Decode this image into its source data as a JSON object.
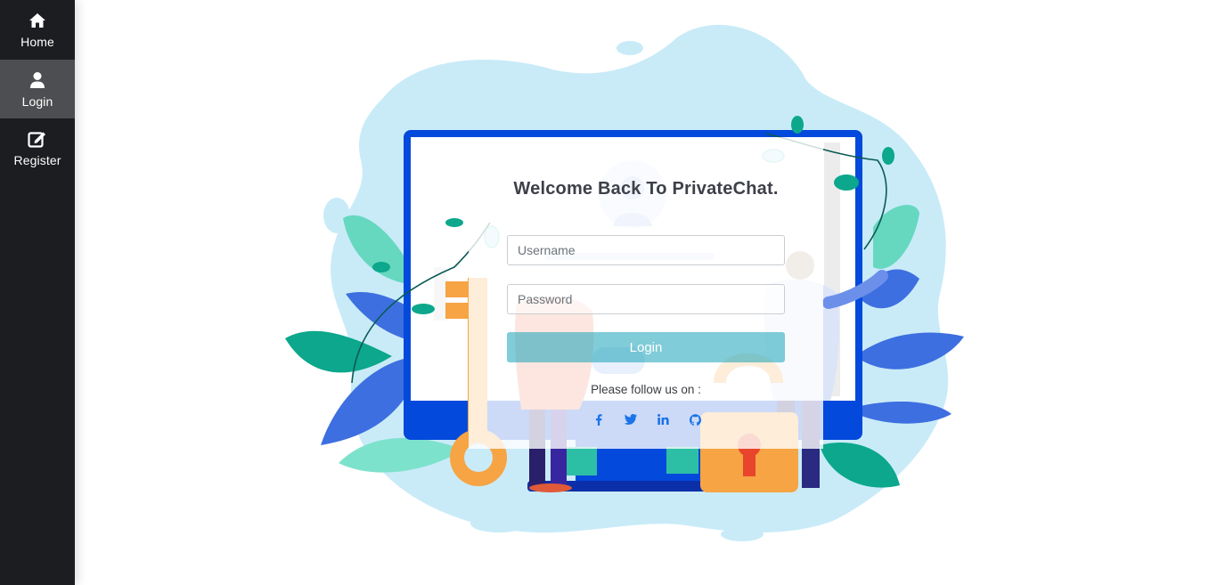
{
  "sidebar": {
    "items": [
      {
        "label": "Home",
        "icon": "home-icon",
        "active": false
      },
      {
        "label": "Login",
        "icon": "user-icon",
        "active": true
      },
      {
        "label": "Register",
        "icon": "edit-icon",
        "active": false
      }
    ]
  },
  "login": {
    "title": "Welcome Back To PrivateChat.",
    "username_placeholder": "Username",
    "password_placeholder": "Password",
    "button_label": "Login",
    "follow_text": "Please follow us on :",
    "socials": [
      "facebook-icon",
      "twitter-icon",
      "linkedin-icon",
      "github-icon"
    ]
  },
  "colors": {
    "sidebar_bg": "#1c1d20",
    "sidebar_active": "#4d4e51",
    "button": "#17a2b8",
    "social": "#1a73e8"
  }
}
